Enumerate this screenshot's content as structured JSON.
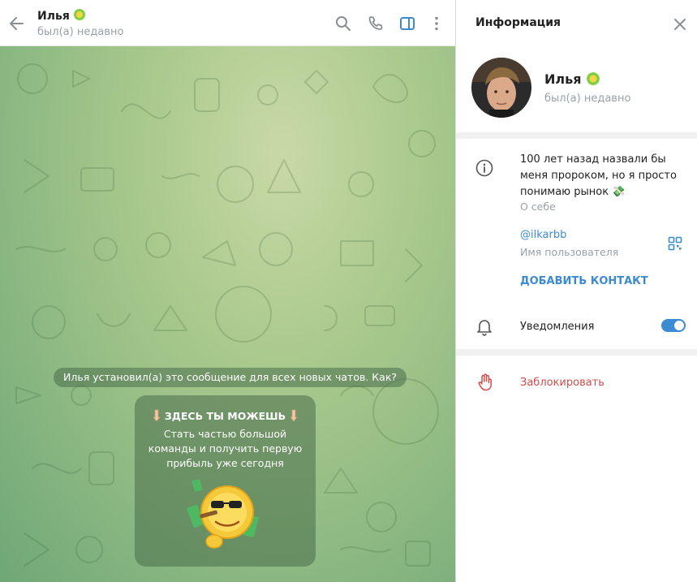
{
  "chat": {
    "name": "Илья",
    "status": "был(а) недавно",
    "service_message": "Илья установил(а) это сообщение для всех новых чатов. Как?",
    "promo": {
      "title": "ЗДЕСЬ ТЫ МОЖЕШЬ",
      "text": "Стать частью большой команды и получить первую прибыль уже сегодня"
    }
  },
  "header_icons": [
    "back-arrow-icon",
    "search-icon",
    "phone-icon",
    "sidebar-toggle-icon",
    "more-vertical-icon"
  ],
  "info": {
    "title": "Информация",
    "name": "Илья",
    "status": "был(а) недавно",
    "about": "100 лет назад назвали бы меня пророком, но я просто понимаю рынок 💸",
    "about_label": "О себе",
    "username": "@ilkarbb",
    "username_label": "Имя пользователя",
    "add_contact": "ДОБАВИТЬ КОНТАКТ",
    "notifications_label": "Уведомления",
    "notifications_enabled": true,
    "block": "Заблокировать"
  },
  "colors": {
    "accent": "#3a8bd1",
    "danger": "#d14b4b",
    "muted": "#9aa0a6",
    "badge": "#7fcf3f"
  }
}
